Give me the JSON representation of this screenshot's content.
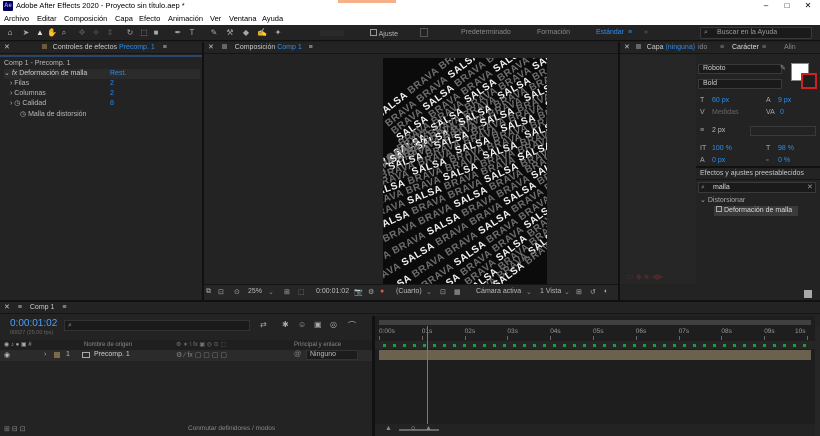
{
  "app": {
    "title": "Adobe After Effects 2020 - Proyecto sin título.aep *",
    "logo": "Ae"
  },
  "menu": [
    "Archivo",
    "Editar",
    "Composición",
    "Capa",
    "Efecto",
    "Animación",
    "Ver",
    "Ventana",
    "Ayuda"
  ],
  "toolbar": {
    "ajuste_label": "Ajuste",
    "workspaces": [
      "Predeterminado",
      "Formación",
      "Estándar"
    ],
    "active_workspace": "Estándar",
    "search_placeholder": "Buscar en la Ayuda"
  },
  "effects_panel": {
    "title": "Controles de efectos",
    "target": "Precomp. 1",
    "breadcrumb": "Comp 1 - Precomp. 1",
    "effect_name": "Deformación de malla",
    "reset": "Rest.",
    "props": [
      {
        "name": "Filas",
        "value": "2"
      },
      {
        "name": "Columnas",
        "value": "2"
      },
      {
        "name": "Calidad",
        "value": "8"
      },
      {
        "name": "Malla de distorsión",
        "value": ""
      }
    ]
  },
  "comp_panel": {
    "title": "Composición",
    "target": "Comp 1",
    "canvas_word": "SALSA",
    "canvas_alt": "BRAVA",
    "footer": {
      "zoom": "25%",
      "time": "0:00:01:02",
      "resolution": "(Cuarto)",
      "camera": "Cámara activa",
      "views": "1 Vista"
    }
  },
  "layer_panel": {
    "title": "Capa",
    "target": "(ninguna)",
    "extra": "ido"
  },
  "character_panel": {
    "title": "Carácter",
    "tab2": "Alin",
    "font": "Roboto",
    "style": "Bold",
    "size": "60 px",
    "leading": "9 px",
    "kerning": "Medidas",
    "tracking": "0",
    "stroke": "2 px",
    "vscale": "100 %",
    "hscale": "98 %",
    "baseline": "0 px",
    "tsume": "0 %"
  },
  "effects_presets": {
    "title": "Efectos y ajustes preestablecidos",
    "search_value": "malla",
    "group": "Distorsionar",
    "item": "Deformación de malla"
  },
  "timeline": {
    "tab": "Comp 1",
    "time": "0:00:01:02",
    "frames": "00027 (25.00 fps)",
    "search_placeholder": "",
    "col_source": "Nombre de origen",
    "col_parent": "Principal y enlace",
    "layer": {
      "num": "1",
      "name": "Precomp. 1",
      "parent": "Ninguno"
    },
    "ruler": [
      "0:00s",
      "01s",
      "02s",
      "03s",
      "04s",
      "05s",
      "06s",
      "07s",
      "08s",
      "09s",
      "10s"
    ],
    "playhead_fraction": 0.112,
    "footer": "Conmutar definidores / modos"
  }
}
